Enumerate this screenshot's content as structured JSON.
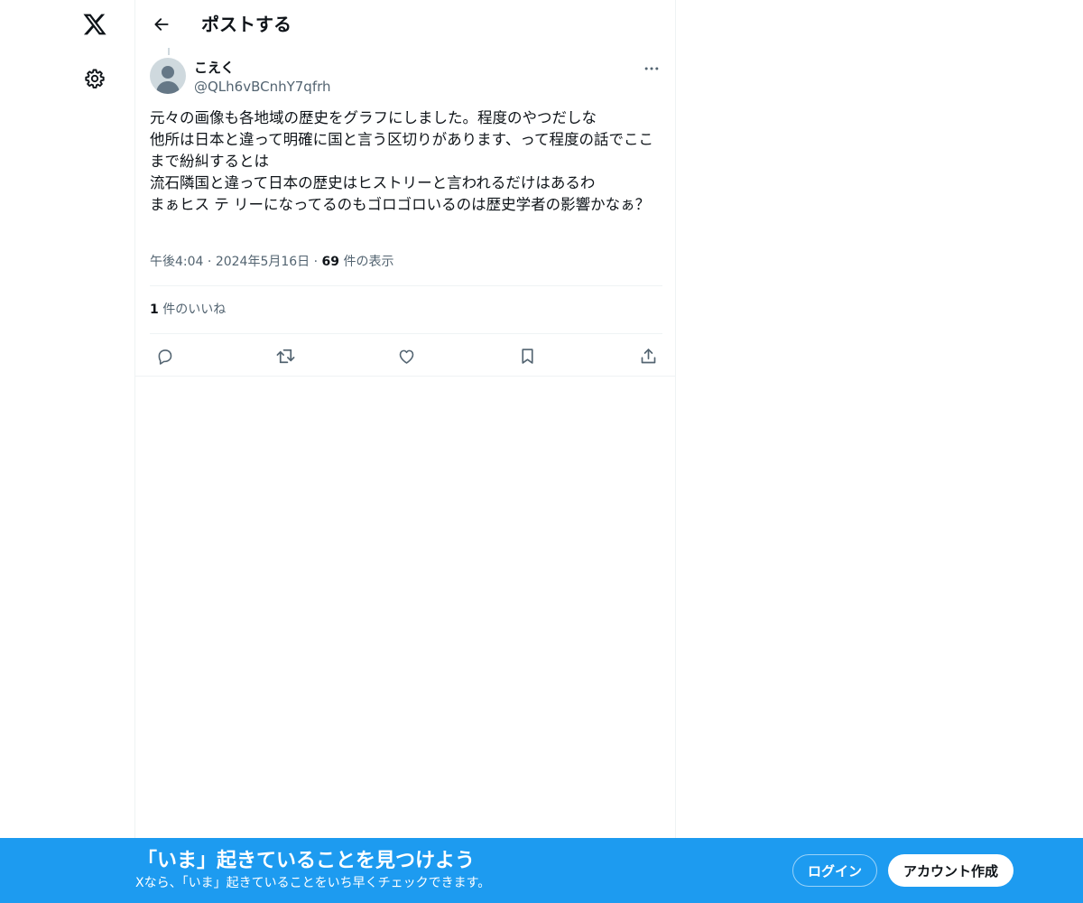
{
  "header": {
    "title": "ポストする"
  },
  "tweet": {
    "display_name": "こえく",
    "handle": "@QLh6vBCnhY7qfrh",
    "text": "元々の画像も各地域の歴史をグラフにしました。程度のやつだしな\n他所は日本と違って明確に国と言う区切りがあります、って程度の話でここまで紛糾するとは\n流石隣国と違って日本の歴史はヒストリーと言われるだけはあるわ\nまぁヒス テ リーになってるのもゴロゴロいるのは歴史学者の影響かなぁ？",
    "time": "午後4:04",
    "date": "2024年5月16日",
    "separator": "·",
    "views_count": "69",
    "views_label": "件の表示",
    "likes_count": "1",
    "likes_label": "件のいいね"
  },
  "actions": [
    "reply-icon",
    "retweet-icon",
    "like-icon",
    "bookmark-icon",
    "share-icon"
  ],
  "banner": {
    "title": "「いま」起きていることを見つけよう",
    "subtitle": "Xなら、「いま」起きていることをいち早くチェックできます。",
    "login_label": "ログイン",
    "signup_label": "アカウント作成"
  },
  "colors": {
    "accent": "#1d9bf0",
    "text_primary": "#0f1419",
    "text_secondary": "#536471",
    "divider": "#eff3f4"
  }
}
